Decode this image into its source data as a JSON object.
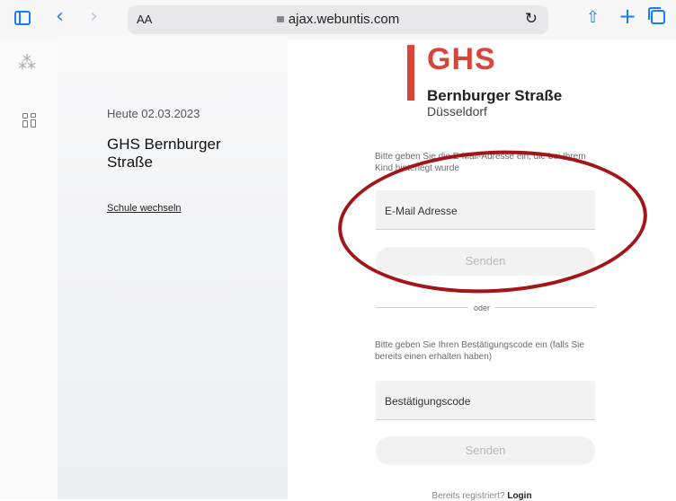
{
  "browser": {
    "reader_label": "AA",
    "url": "ajax.webuntis.com",
    "back_glyph": "‹",
    "forward_glyph": "›",
    "reload_glyph": "↻",
    "share_glyph": "⇧",
    "new_tab_glyph": "+",
    "accent_color": "#1a7cf2"
  },
  "rail": {
    "icons": [
      "loading-spinner-icon",
      "dashboard-icon"
    ],
    "spinner_glyph": "⁂"
  },
  "school": {
    "today": "Heute 02.03.2023",
    "name": "GHS Bernburger Straße",
    "switch_link": "Schule wechseln"
  },
  "logo": {
    "abbr": "GHS",
    "street": "Bernburger Straße",
    "city": "Düsseldorf",
    "brand_color": "#d8453a"
  },
  "email_section": {
    "hint": "Bitte geben Sie die E-Mail-Adresse ein, die bei Ihrem Kind hinterlegt wurde",
    "input_placeholder": "E-Mail Adresse",
    "button_label": "Senden"
  },
  "divider_label": "oder",
  "code_section": {
    "hint": "Bitte geben Sie Ihren Bestätigungscode ein (falls Sie bereits einen erhalten haben)",
    "input_placeholder": "Bestätigungscode",
    "button_label": "Senden"
  },
  "footer": {
    "text": "Bereits registriert?",
    "link": "Login"
  },
  "annotation_color": "#a3151b"
}
